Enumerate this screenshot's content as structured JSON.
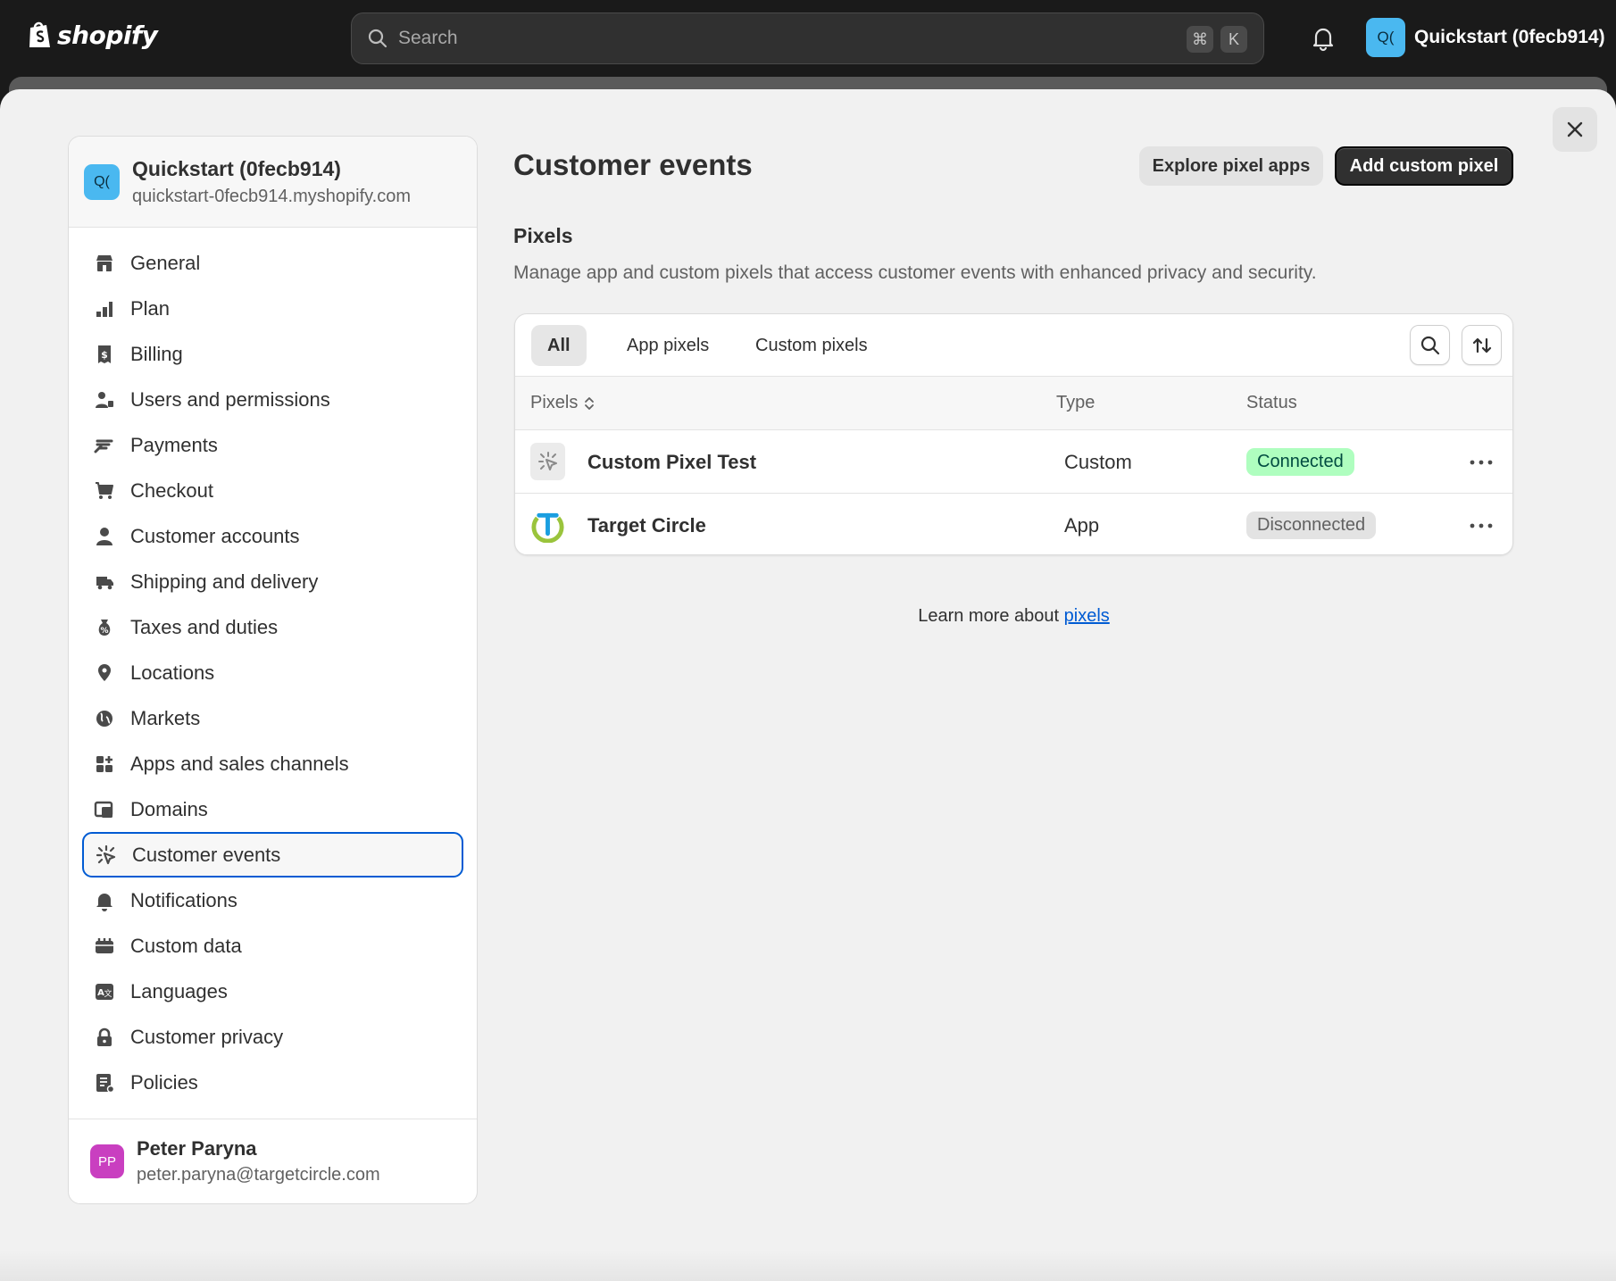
{
  "topbar": {
    "logo_text": "shopify",
    "search_placeholder": "Search",
    "shortcut_cmd": "⌘",
    "shortcut_key": "K",
    "store_initials": "Q(",
    "store_name": "Quickstart (0fecb914)"
  },
  "sidebar": {
    "store_initials": "Q(",
    "store_name": "Quickstart (0fecb914)",
    "store_domain": "quickstart-0fecb914.myshopify.com",
    "items": [
      {
        "label": "General",
        "icon": "store-icon"
      },
      {
        "label": "Plan",
        "icon": "plan-icon"
      },
      {
        "label": "Billing",
        "icon": "billing-icon"
      },
      {
        "label": "Users and permissions",
        "icon": "users-icon"
      },
      {
        "label": "Payments",
        "icon": "payments-icon"
      },
      {
        "label": "Checkout",
        "icon": "cart-icon"
      },
      {
        "label": "Customer accounts",
        "icon": "person-icon"
      },
      {
        "label": "Shipping and delivery",
        "icon": "truck-icon"
      },
      {
        "label": "Taxes and duties",
        "icon": "taxes-icon"
      },
      {
        "label": "Locations",
        "icon": "location-pin-icon"
      },
      {
        "label": "Markets",
        "icon": "globe-icon"
      },
      {
        "label": "Apps and sales channels",
        "icon": "apps-icon"
      },
      {
        "label": "Domains",
        "icon": "domains-icon"
      },
      {
        "label": "Customer events",
        "icon": "cursor-click-icon",
        "active": true
      },
      {
        "label": "Notifications",
        "icon": "bell-icon"
      },
      {
        "label": "Custom data",
        "icon": "custom-data-icon"
      },
      {
        "label": "Languages",
        "icon": "languages-icon"
      },
      {
        "label": "Customer privacy",
        "icon": "lock-icon"
      },
      {
        "label": "Policies",
        "icon": "policies-icon"
      }
    ],
    "user": {
      "initials": "PP",
      "name": "Peter Paryna",
      "email": "peter.paryna@targetcircle.com"
    }
  },
  "main": {
    "title": "Customer events",
    "explore_button": "Explore pixel apps",
    "add_button": "Add custom pixel",
    "section_title": "Pixels",
    "section_desc": "Manage app and custom pixels that access customer events with enhanced privacy and security.",
    "tabs": [
      "All",
      "App pixels",
      "Custom pixels"
    ],
    "columns": {
      "pixels": "Pixels",
      "type": "Type",
      "status": "Status"
    },
    "rows": [
      {
        "name": "Custom Pixel Test",
        "type": "Custom",
        "status": "Connected"
      },
      {
        "name": "Target Circle",
        "type": "App",
        "status": "Disconnected"
      }
    ],
    "learn_prefix": "Learn more about ",
    "learn_link": "pixels"
  },
  "colors": {
    "accent_blue": "#005bd3",
    "connected_bg": "#affebf",
    "store_avatar": "#4ab8f0",
    "user_avatar": "#c93fc0"
  }
}
